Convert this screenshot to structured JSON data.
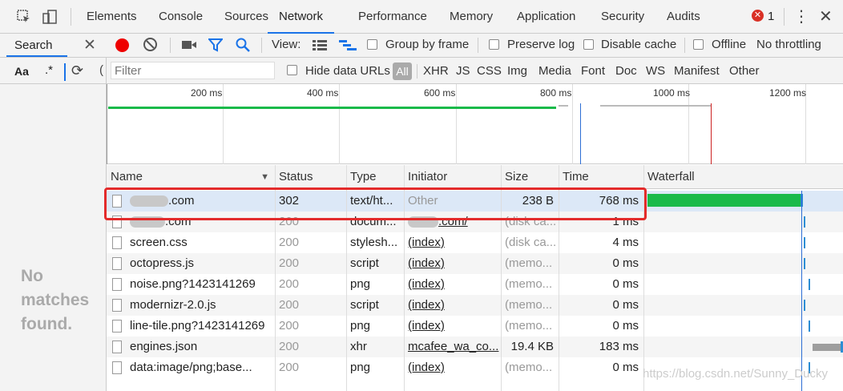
{
  "toolbar": {
    "tabs": [
      "Elements",
      "Console",
      "Sources",
      "Network",
      "Performance",
      "Memory",
      "Application",
      "Security",
      "Audits"
    ],
    "active_tab": "Network",
    "error_count": "1",
    "error_icon": "✕",
    "more_icon": "⋮",
    "close_icon": "✕"
  },
  "search": {
    "label": "Search",
    "close": "✕",
    "aa": "Aa",
    "regex": ".*",
    "no_matches": "No matches found."
  },
  "network_bar": {
    "view_label": "View:",
    "group_by_frame": "Group by frame",
    "preserve_log": "Preserve log",
    "disable_cache": "Disable cache",
    "offline": "Offline",
    "throttling": "No throttling"
  },
  "filter": {
    "placeholder": "Filter",
    "hide_data_urls": "Hide data URLs",
    "types": [
      "All",
      "XHR",
      "JS",
      "CSS",
      "Img",
      "Media",
      "Font",
      "Doc",
      "WS",
      "Manifest",
      "Other"
    ]
  },
  "timeline": {
    "ticks": [
      "200 ms",
      "400 ms",
      "600 ms",
      "800 ms",
      "1000 ms",
      "1200 ms"
    ]
  },
  "table": {
    "columns": [
      "Name",
      "Status",
      "Type",
      "Initiator",
      "Size",
      "Time",
      "Waterfall"
    ],
    "sort_indicator": "▼",
    "rows": [
      {
        "name": ".com",
        "status": "302",
        "type": "text/ht...",
        "initiator": "Other",
        "size": "238 B",
        "time": "768 ms",
        "wf_start": 0.0,
        "wf_end": 0.783,
        "wf_color": "#1aba4a"
      },
      {
        "name": ".com",
        "status": "200",
        "type": "docum...",
        "initiator": ".com/",
        "size": "(disk ca...",
        "time": "1 ms",
        "wf_start": 0.8,
        "wf_end": 0.807,
        "wf_color": "#2d8ed4"
      },
      {
        "name": "screen.css",
        "status": "200",
        "type": "stylesh...",
        "initiator": "(index)",
        "size": "(disk ca...",
        "time": "4 ms",
        "wf_start": 0.8,
        "wf_end": 0.809,
        "wf_color": "#2d8ed4"
      },
      {
        "name": "octopress.js",
        "status": "200",
        "type": "script",
        "initiator": "(index)",
        "size": "(memo...",
        "time": "0 ms",
        "wf_start": 0.8,
        "wf_end": 0.807,
        "wf_color": "#2d8ed4"
      },
      {
        "name": "noise.png?1423141269",
        "status": "200",
        "type": "png",
        "initiator": "(index)",
        "size": "(memo...",
        "time": "0 ms",
        "wf_start": 0.825,
        "wf_end": 0.832,
        "wf_color": "#2d8ed4"
      },
      {
        "name": "modernizr-2.0.js",
        "status": "200",
        "type": "script",
        "initiator": "(index)",
        "size": "(memo...",
        "time": "0 ms",
        "wf_start": 0.8,
        "wf_end": 0.807,
        "wf_color": "#2d8ed4"
      },
      {
        "name": "line-tile.png?1423141269",
        "status": "200",
        "type": "png",
        "initiator": "(index)",
        "size": "(memo...",
        "time": "0 ms",
        "wf_start": 0.825,
        "wf_end": 0.832,
        "wf_color": "#2d8ed4"
      },
      {
        "name": "engines.json",
        "status": "200",
        "type": "xhr",
        "initiator": "mcafee_wa_co...",
        "size": "19.4 KB",
        "time": "183 ms",
        "wf_start": 0.845,
        "wf_end": 1.0,
        "wf_color": "#9e9e9e"
      },
      {
        "name": "data:image/png;base...",
        "status": "200",
        "type": "png",
        "initiator": "(index)",
        "size": "(memo...",
        "time": "0 ms",
        "wf_start": 0.825,
        "wf_end": 0.832,
        "wf_color": "#2d8ed4"
      }
    ]
  },
  "watermark": "https://blog.csdn.net/Sunny_Ducky"
}
